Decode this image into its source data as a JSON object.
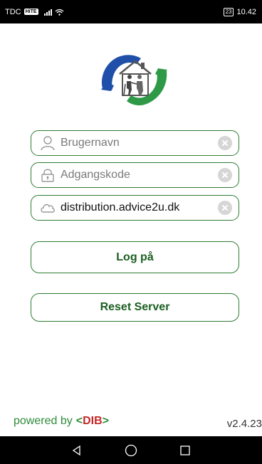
{
  "status_bar": {
    "carrier": "TDC",
    "carrier_badge": "HiTE",
    "battery": "23",
    "time": "10.42"
  },
  "login": {
    "username_placeholder": "Brugernavn",
    "password_placeholder": "Adgangskode",
    "server_value": "distribution.advice2u.dk",
    "login_label": "Log på",
    "reset_label": "Reset Server"
  },
  "footer": {
    "powered_by": "powered by",
    "brand_left": "<",
    "brand_name": "DIB",
    "brand_right": ">",
    "version": "v2.4.23"
  },
  "colors": {
    "accent": "#2e7d32",
    "brand_red": "#c62828",
    "logo_blue": "#1f4fa8",
    "logo_green": "#2e9a47"
  },
  "icons": {
    "user": "user-outline-icon",
    "lock": "lock-icon",
    "cloud": "cloud-icon",
    "clear": "clear-circle-icon"
  }
}
